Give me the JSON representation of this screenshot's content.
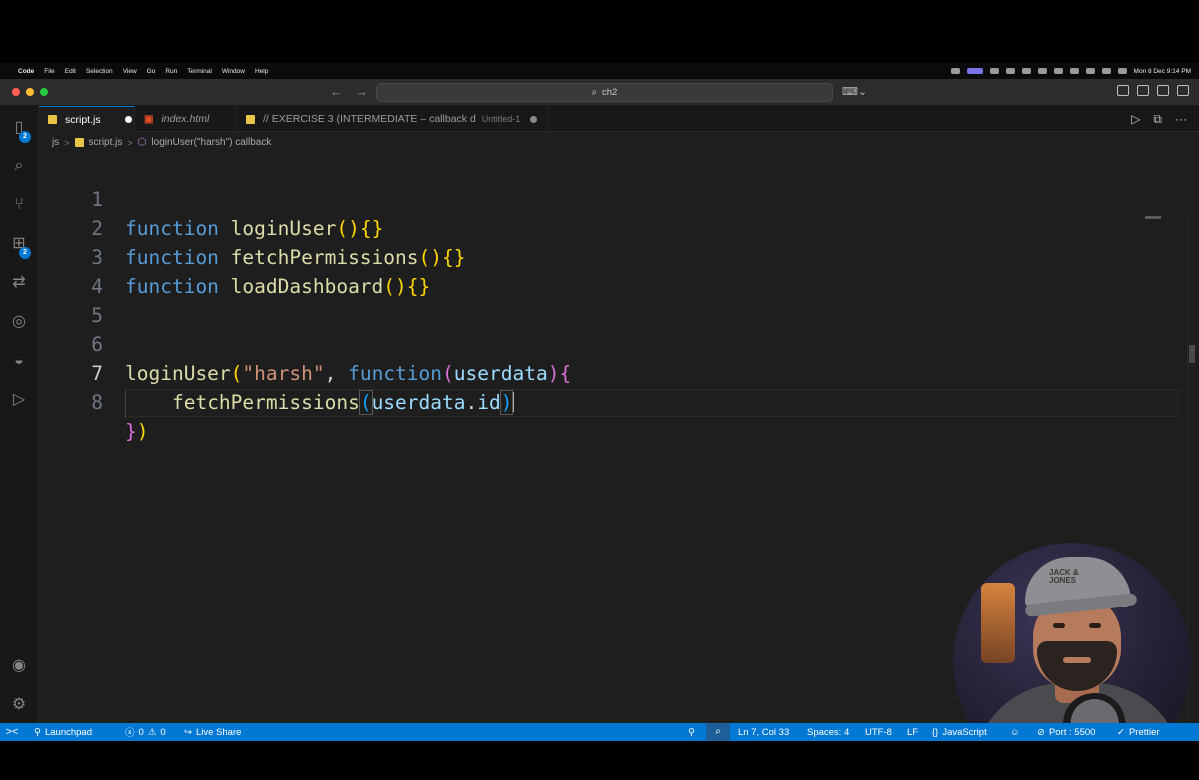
{
  "menubar": {
    "apple": "",
    "items": [
      "Code",
      "File",
      "Edit",
      "Selection",
      "View",
      "Go",
      "Run",
      "Terminal",
      "Window",
      "Help"
    ],
    "clock": "Mon 8 Dec  9:14 PM"
  },
  "titlebar": {
    "back": "←",
    "forward": "→",
    "search_icon": "⌕",
    "search": "ch2",
    "copilot": "⌨︎⌄"
  },
  "activity": {
    "explorer_badge": "2",
    "extensions_badge": "2"
  },
  "tabs": [
    {
      "label": "script.js",
      "icon": "js-icon",
      "modified": true,
      "active": true
    },
    {
      "label": "index.html",
      "icon": "html-icon",
      "italic": true
    },
    {
      "label": "// EXERCISE 3 (INTERMEDIATE – callback d",
      "desc": "Untitled-1",
      "icon": "js-icon",
      "modified": true
    }
  ],
  "tab_actions": {
    "run": "▷",
    "split": "⧉",
    "more": "···"
  },
  "breadcrumb": {
    "folder": "js",
    "file": "script.js",
    "symbol": "loginUser(\"harsh\") callback",
    "sep": ">"
  },
  "editor": {
    "line_numbers": [
      "1",
      "2",
      "3",
      "4",
      "5",
      "6",
      "7",
      "8"
    ],
    "current_line": 7,
    "tokens": {
      "l1": {
        "kw": "function",
        "name": "loginUser",
        "br": "(){}"
      },
      "l2": {
        "kw": "function",
        "name": "fetchPermissions",
        "br": "(){}"
      },
      "l3": {
        "kw": "function",
        "name": "loadDashboard",
        "br": "(){}"
      },
      "l6": {
        "name": "loginUser",
        "p1": "(",
        "str": "\"harsh\"",
        "comma": ", ",
        "kw": "function",
        "p2": "(",
        "param": "userdata",
        "p3": ")",
        "brace": "{"
      },
      "l7": {
        "indent": "    ",
        "name": "fetchPermissions",
        "p1": "(",
        "obj": "userdata",
        "dot": ".",
        "prop": "id",
        "p2": ")"
      },
      "l8": {
        "brace": "}",
        "paren": ")"
      }
    }
  },
  "statusbar": {
    "remote": "><",
    "launchpad": "Launchpad",
    "errors": "0",
    "warnings": "0",
    "liveshare": "Live Share",
    "position": "Ln 7, Col 33",
    "spaces": "Spaces: 4",
    "encoding": "UTF-8",
    "eol": "LF",
    "language": "JavaScript",
    "port": "Port : 5500",
    "prettier": "Prettier"
  },
  "colors": {
    "accent": "#0078d4",
    "keyword": "#569cd6",
    "function": "#dcdcaa",
    "string": "#ce9178",
    "param": "#9cdcfe"
  }
}
